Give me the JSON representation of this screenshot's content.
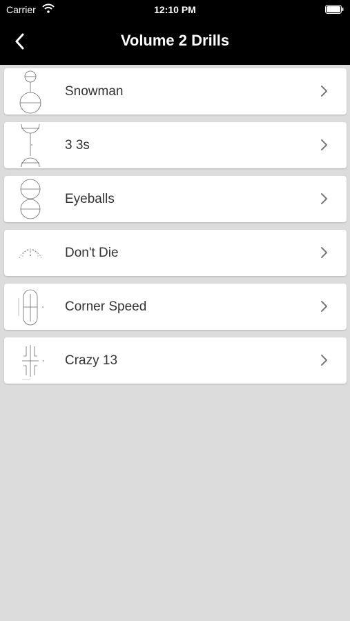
{
  "status_bar": {
    "carrier": "Carrier",
    "time": "12:10 PM",
    "icons": [
      "wifi-icon",
      "battery-icon"
    ]
  },
  "nav": {
    "title": "Volume 2 Drills",
    "back_icon": "chevron-left-icon"
  },
  "drills": [
    {
      "label": "Snowman",
      "icon": "snowman-diagram-icon"
    },
    {
      "label": "3 3s",
      "icon": "three-threes-diagram-icon"
    },
    {
      "label": "Eyeballs",
      "icon": "eyeballs-diagram-icon"
    },
    {
      "label": "Don't Die",
      "icon": "dont-die-diagram-icon"
    },
    {
      "label": "Corner Speed",
      "icon": "corner-speed-diagram-icon"
    },
    {
      "label": "Crazy 13",
      "icon": "crazy-13-diagram-icon"
    }
  ],
  "colors": {
    "nav_background": "#000000",
    "list_background": "#dcdcdc",
    "row_background": "#ffffff",
    "label_text": "#333333",
    "chevron": "#777777"
  }
}
